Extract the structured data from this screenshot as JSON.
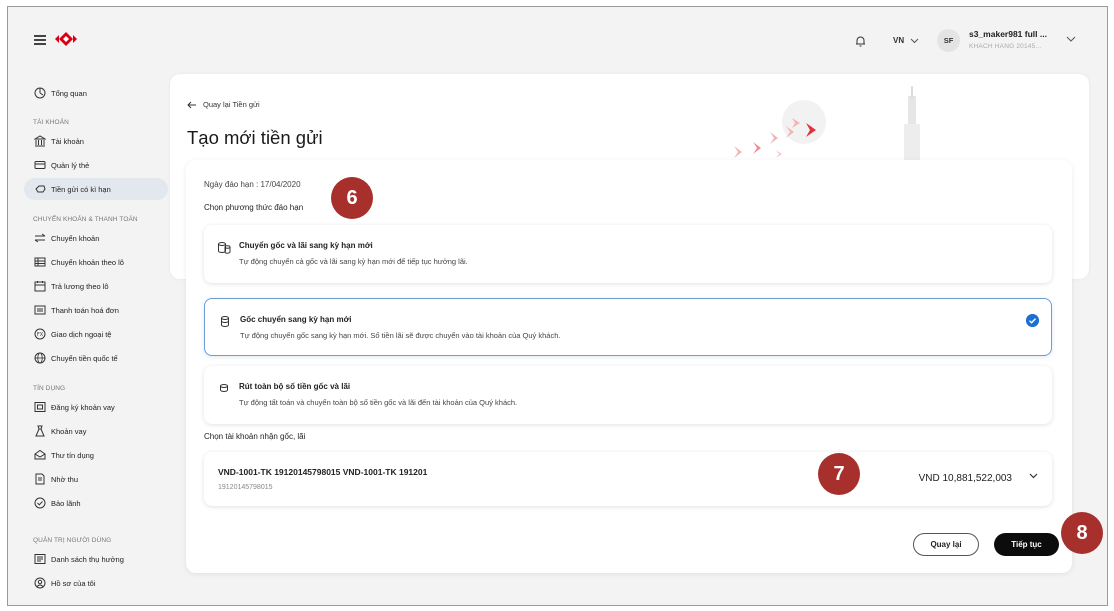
{
  "topbar": {
    "language": "VN",
    "avatar_initials": "SF",
    "user_name": "s3_maker981 full ...",
    "user_sub": "KHACH HANG 20145..."
  },
  "sidebar": {
    "overview": "Tổng quan",
    "sections": {
      "account": "TÀI KHOẢN",
      "transfer": "CHUYỂN KHOẢN & THANH TOÁN",
      "credit": "TÍN DỤNG",
      "user_admin": "QUẢN TRỊ NGƯỜI DÙNG"
    },
    "items": [
      {
        "label": "Tài khoản",
        "icon": "bank-icon"
      },
      {
        "label": "Quản lý thẻ",
        "icon": "card-icon"
      },
      {
        "label": "Tiền gửi có kì hạn",
        "icon": "piggy-bank-icon",
        "active": true
      },
      {
        "label": "Chuyển khoản",
        "icon": "transfer-icon"
      },
      {
        "label": "Chuyển khoản theo lô",
        "icon": "table-icon"
      },
      {
        "label": "Trả lương theo lô",
        "icon": "calendar-icon"
      },
      {
        "label": "Thanh toán hoá đơn",
        "icon": "bill-icon"
      },
      {
        "label": "Giao dịch ngoại tệ",
        "icon": "fx-icon"
      },
      {
        "label": "Chuyển tiền quốc tế",
        "icon": "globe-icon"
      },
      {
        "label": "Đăng ký khoản vay",
        "icon": "loan-register-icon"
      },
      {
        "label": "Khoản vay",
        "icon": "loan-icon"
      },
      {
        "label": "Thư tín dụng",
        "icon": "letter-icon"
      },
      {
        "label": "Nhờ thu",
        "icon": "collection-icon"
      },
      {
        "label": "Bảo lãnh",
        "icon": "guarantee-icon"
      },
      {
        "label": "Danh sách thụ hưởng",
        "icon": "beneficiary-icon"
      },
      {
        "label": "Hồ sơ của tôi",
        "icon": "profile-icon"
      }
    ]
  },
  "header": {
    "back_link": "Quay lại Tiền gửi",
    "title": "Tạo mới tiền gửi"
  },
  "form": {
    "due_date": "Ngày đáo hạn : 17/04/2020",
    "method_label": "Chọn phương thức đáo hạn",
    "options": [
      {
        "title": "Chuyển gốc và lãi sang kỳ hạn mới",
        "desc": "Tự động chuyển cả gốc và lãi sang kỳ hạn mới để tiếp tục hưởng lãi.",
        "selected": false
      },
      {
        "title": "Gốc chuyển sang kỳ hạn mới",
        "desc": "Tự động chuyển gốc sang kỳ hạn mới. Số tiền lãi sẽ được chuyển vào tài khoản của Quý khách.",
        "selected": true
      },
      {
        "title": "Rút toàn bộ số tiền gốc và lãi",
        "desc": "Tự động tất toán và chuyển toàn bộ số tiền gốc và lãi đến tài khoản của Quý khách.",
        "selected": false
      }
    ],
    "account_label": "Chọn tài khoản nhận gốc, lãi",
    "account": {
      "name": "VND-1001-TK 19120145798015 VND-1001-TK 191201",
      "number": "19120145798015",
      "balance": "VND  10,881,522,003"
    },
    "back_button": "Quay lại",
    "next_button": "Tiếp tục"
  },
  "callouts": [
    "6",
    "7",
    "8"
  ],
  "colors": {
    "brand_red": "#db0011",
    "callout": "#a8302c",
    "accent_blue": "#1d6fd3",
    "active_nav": "#e3e8ee"
  }
}
